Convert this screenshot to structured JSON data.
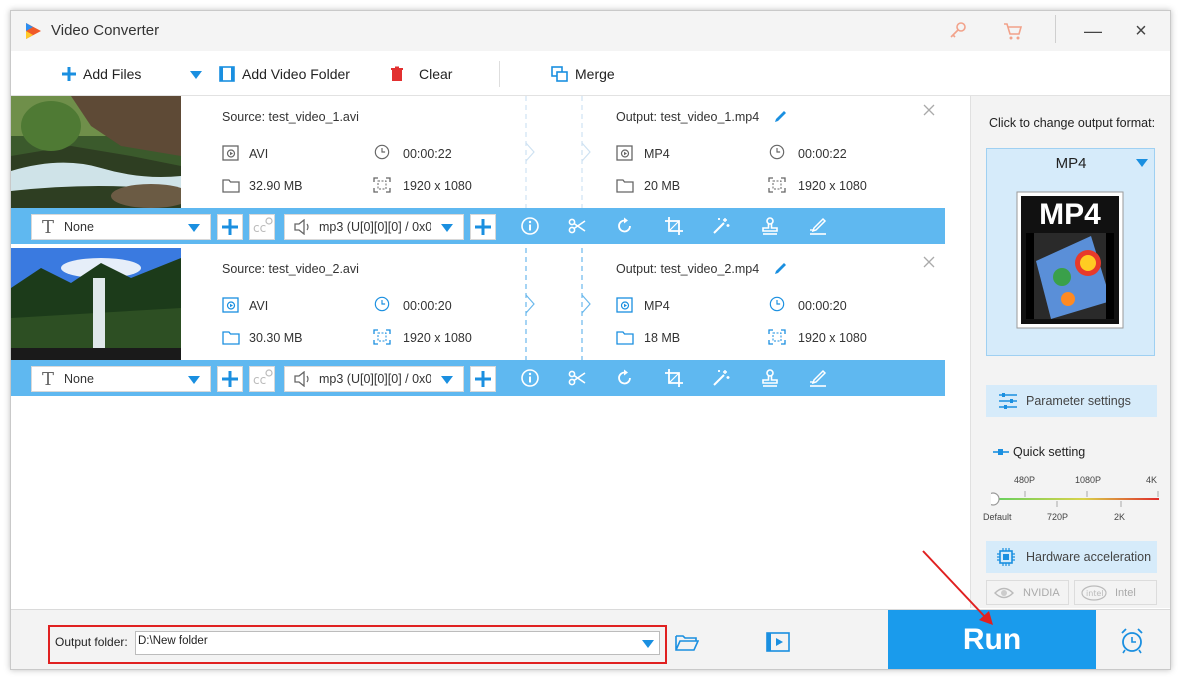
{
  "window": {
    "title": "Video Converter"
  },
  "toolbar": {
    "add_files": "Add Files",
    "add_video_folder": "Add Video Folder",
    "clear": "Clear",
    "merge": "Merge"
  },
  "items": [
    {
      "source": "Source: test_video_1.avi",
      "output": "Output: test_video_1.mp4",
      "src_format": "AVI",
      "src_duration": "00:00:22",
      "src_size": "32.90 MB",
      "src_resolution": "1920 x 1080",
      "out_format": "MP4",
      "out_duration": "00:00:22",
      "out_size": "20 MB",
      "out_resolution": "1920 x 1080",
      "subtitle": "None",
      "audio": "mp3 (U[0][0][0] / 0x0("
    },
    {
      "source": "Source: test_video_2.avi",
      "output": "Output: test_video_2.mp4",
      "src_format": "AVI",
      "src_duration": "00:00:20",
      "src_size": "30.30 MB",
      "src_resolution": "1920 x 1080",
      "out_format": "MP4",
      "out_duration": "00:00:20",
      "out_size": "18 MB",
      "out_resolution": "1920 x 1080",
      "subtitle": "None",
      "audio": "mp3 (U[0][0][0] / 0x0("
    }
  ],
  "right_panel": {
    "hint": "Click to change output format:",
    "format": "MP4",
    "format_art_text": "MP4",
    "parameter_settings": "Parameter settings",
    "quick_setting": "Quick setting",
    "quality_top": [
      "480P",
      "1080P",
      "4K"
    ],
    "quality_bottom": [
      "Default",
      "720P",
      "2K"
    ],
    "hardware_acceleration": "Hardware acceleration",
    "nvidia": "NVIDIA",
    "intel": "Intel"
  },
  "bottom": {
    "output_folder_label": "Output folder:",
    "output_folder_value": "D:\\New folder",
    "run": "Run"
  },
  "colors": {
    "accent": "#1a9bec",
    "bar": "#5fb8f0",
    "highlight_red": "#e02020"
  }
}
